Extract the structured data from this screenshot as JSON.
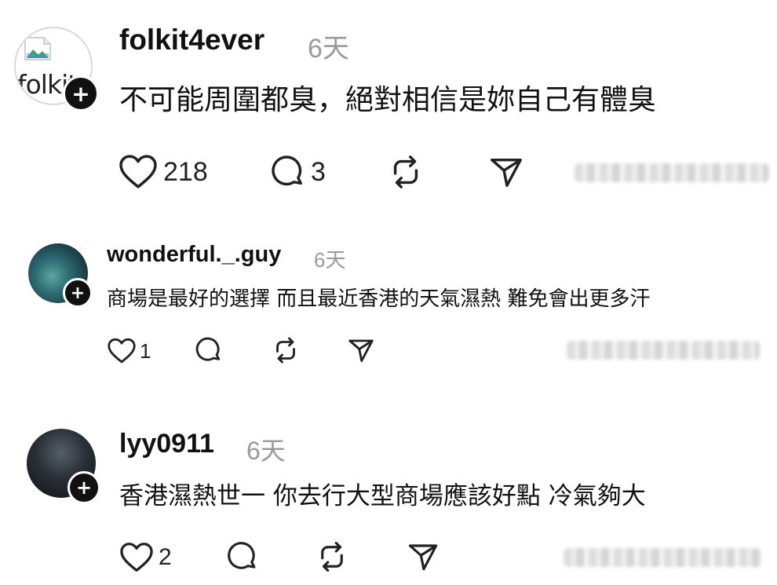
{
  "comments": [
    {
      "username": "folkit4ever",
      "time": "6天",
      "avatar_alt": "folkit",
      "follow_symbol": "+",
      "text": "不可能周圍都臭，絕對相信是妳自己有體臭",
      "likes": "218",
      "replies": "3",
      "reposts": "",
      "sends": ""
    },
    {
      "username": "wonderful._.guy",
      "time": "6天",
      "follow_symbol": "+",
      "text": "商場是最好的選擇 而且最近香港的天氣濕熱 難免會出更多汗",
      "likes": "1",
      "replies": "",
      "reposts": "",
      "sends": ""
    },
    {
      "username": "lyy0911",
      "time": "6天",
      "follow_symbol": "+",
      "text": "香港濕熱世一 你去行大型商場應該好點 冷氣夠大",
      "likes": "2",
      "replies": "",
      "reposts": "",
      "sends": ""
    }
  ],
  "icons": {
    "like": "heart-icon",
    "reply": "comment-bubble-icon",
    "repost": "repost-icon",
    "share": "send-icon",
    "follow": "plus-icon"
  },
  "colors": {
    "text": "#111111",
    "muted": "#9a9a9a",
    "badge": "#111111"
  }
}
